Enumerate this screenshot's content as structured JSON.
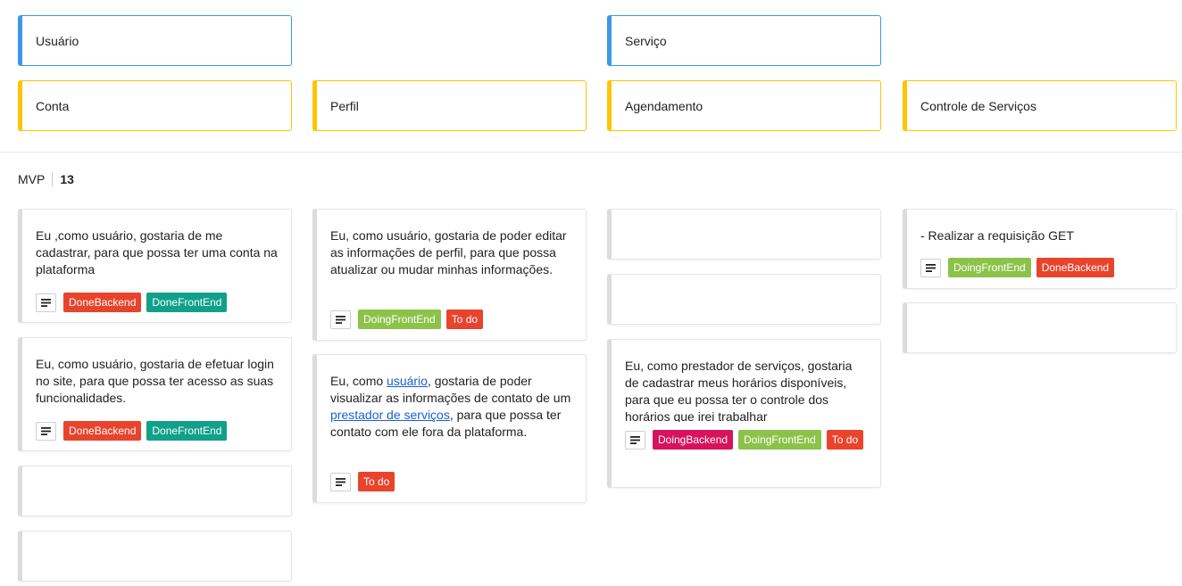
{
  "activities": [
    {
      "label": "Usuário"
    },
    {
      "label": "Serviço"
    }
  ],
  "tasks": [
    {
      "label": "Conta"
    },
    {
      "label": "Perfil"
    },
    {
      "label": "Agendamento"
    },
    {
      "label": "Controle de Serviços"
    }
  ],
  "release": {
    "name": "MVP",
    "points": "13"
  },
  "colors": {
    "DoneBackend": "#e8442d",
    "DoneFrontEnd": "#11a08a",
    "DoingFrontEnd": "#8bc34a",
    "DoingBackend": "#d6135c",
    "To do": "#e8442d",
    "activity_border": "#3b99e8",
    "task_border": "#ffc400"
  },
  "stories": {
    "s1": {
      "text": "Eu ,como usuário, gostaria de me cadastrar, para que possa ter uma conta na plataforma",
      "tags": [
        "DoneBackend",
        "DoneFrontEnd"
      ]
    },
    "s2": {
      "text": "Eu, como usuário, gostaria de efetuar login no site, para que possa ter acesso as suas funcionalidades.",
      "tags": [
        "DoneBackend",
        "DoneFrontEnd"
      ]
    },
    "s3": {
      "text": "Eu, como usuário, gostaria de poder editar as informações de perfil, para que possa atualizar ou mudar minhas informações.",
      "tags": [
        "DoingFrontEnd",
        "To do"
      ]
    },
    "s4": {
      "pre": "Eu, como ",
      "link1": "usuário",
      "mid": ", gostaria de poder visualizar as informações de contato de um ",
      "link2": "prestador de serviços",
      "post": ", para que possa ter contato com ele fora da plataforma.",
      "tags": [
        "To do"
      ]
    },
    "s5": {
      "text": "Eu, como prestador de serviços, gostaria de cadastrar meus horários disponíveis, para que eu possa ter o controle dos horários que irei trabalhar",
      "tags": [
        "DoingBackend",
        "DoingFrontEnd",
        "To do"
      ]
    },
    "s6": {
      "text": "- Realizar a requisição GET",
      "tags": [
        "DoingFrontEnd",
        "DoneBackend"
      ]
    }
  },
  "icons": {
    "description": "text-lines-icon"
  }
}
